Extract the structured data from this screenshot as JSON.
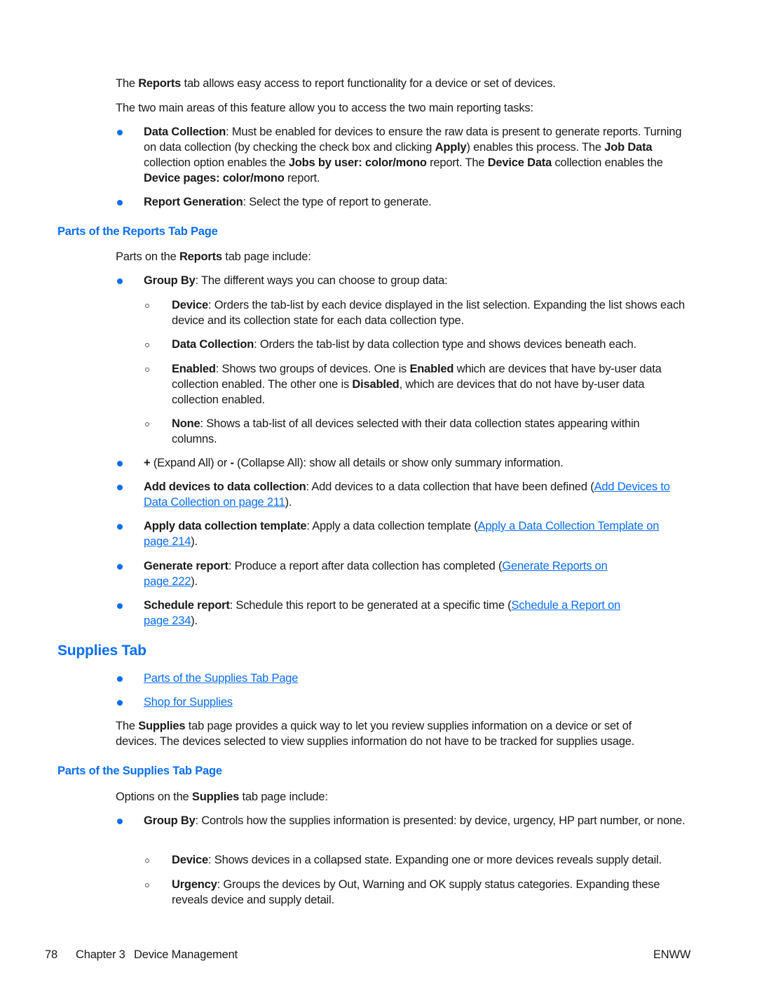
{
  "colors": {
    "accent": "#0a6ef0",
    "text": "#1a1a1a"
  },
  "intro": {
    "p1": {
      "pre": "The ",
      "bold": "Reports",
      "post": " tab allows easy access to report functionality for a device or set of devices."
    },
    "p2": "The two main areas of this feature allow you to access the two main reporting tasks:"
  },
  "main_bullets": [
    {
      "bold": "Data Collection",
      "t1": ": Must be enabled for devices to ensure the raw data is present to generate reports. Turning on data collection (by checking the check box and clicking ",
      "b2": "Apply",
      "t2": ") enables this process. The ",
      "b3": "Job Data",
      "t3": " collection option enables the ",
      "b4": "Jobs by user: color/mono",
      "t4": " report. The ",
      "b5": "Device Data",
      "t5": " collection enables the ",
      "b6": "Device pages: color/mono",
      "t6": " report."
    },
    {
      "bold": "Report Generation",
      "text": ": Select the type of report to generate."
    }
  ],
  "reports_section": {
    "heading": "Parts of the Reports Tab Page",
    "intro": {
      "pre": "Parts on the ",
      "bold": "Reports",
      "post": " tab page include:"
    },
    "group_by": {
      "bold": "Group By",
      "text": ": The different ways you can choose to group data:"
    },
    "group_by_options": [
      {
        "bold": "Device",
        "text": ": Orders the tab-list by each device displayed in the list selection. Expanding the list shows each device and its collection state for each data collection type."
      },
      {
        "bold": "Data Collection",
        "text": ": Orders the tab-list by data collection type and shows devices beneath each."
      },
      {
        "bold": "Enabled",
        "t1": ": Shows two groups of devices. One is ",
        "b2": "Enabled",
        "t2": " which are devices that have by-user data collection enabled. The other one is ",
        "b3": "Disabled",
        "t3": ", which are devices that do not have by-user data collection enabled."
      },
      {
        "bold": "None",
        "text": ": Shows a tab-list of all devices selected with their data collection states appearing within columns."
      }
    ],
    "expand": {
      "plus": "+",
      "t1": " (Expand All) or ",
      "minus": "-",
      "t2": " (Collapse All): show all details or show only summary information."
    },
    "items": [
      {
        "bold": "Add devices to data collection",
        "text": ": Add devices to a data collection that have been defined (",
        "link": "Add Devices to Data Collection on page 211",
        "post": ")."
      },
      {
        "bold": "Apply data collection template",
        "text": ": Apply a data collection template (",
        "link": "Apply a Data Collection Template on page 214",
        "post": ")."
      },
      {
        "bold": "Generate report",
        "text": ": Produce a report after data collection has completed (",
        "link": "Generate Reports on page 222",
        "post": ")."
      },
      {
        "bold": "Schedule report",
        "text": ": Schedule this report to be generated at a specific time (",
        "link": "Schedule a Report on page 234",
        "post": ")."
      }
    ]
  },
  "supplies_tab": {
    "heading": "Supplies Tab",
    "links": [
      "Parts of the Supplies Tab Page",
      "Shop for Supplies"
    ],
    "intro": {
      "pre": "The ",
      "bold": "Supplies",
      "post": " tab page provides a quick way to let you review supplies information on a device or set of devices. The devices selected to view supplies information do not have to be tracked for supplies usage."
    }
  },
  "supplies_section": {
    "heading": "Parts of the Supplies Tab Page",
    "intro": {
      "pre": "Options on the ",
      "bold": "Supplies",
      "post": " tab page include:"
    },
    "group_by": {
      "bold": "Group By",
      "text": ": Controls how the supplies information is presented: by device, urgency, HP part number, or none."
    },
    "options": [
      {
        "bold": "Device",
        "text": ": Shows devices in a collapsed state. Expanding one or more devices reveals supply detail."
      },
      {
        "bold": "Urgency",
        "text": ": Groups the devices by Out, Warning and OK supply status categories. Expanding these reveals device and supply detail."
      }
    ]
  },
  "footer": {
    "page_number": "78",
    "chapter": "Chapter 3",
    "chapter_title": "Device Management",
    "right": "ENWW"
  }
}
